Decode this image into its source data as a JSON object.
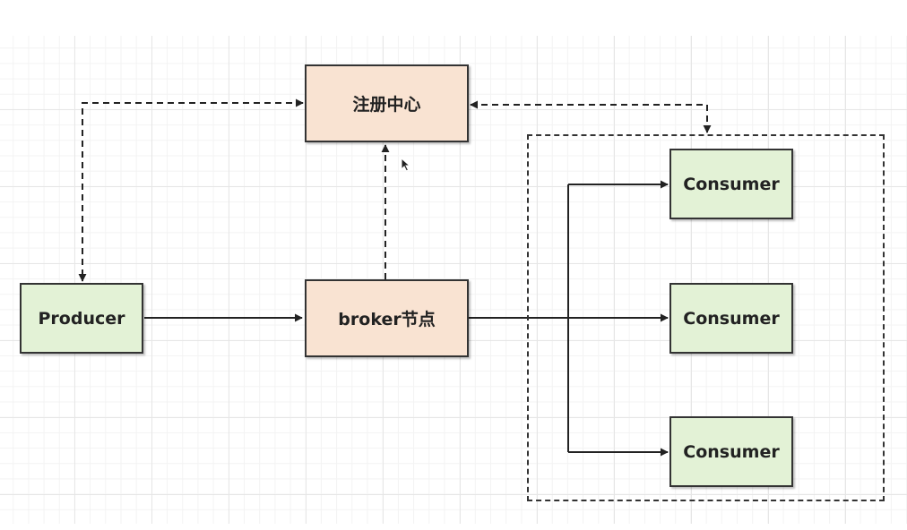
{
  "diagram": {
    "nodes": {
      "registry": {
        "label": "注册中心"
      },
      "producer": {
        "label": "Producer"
      },
      "broker": {
        "label": "broker节点"
      },
      "consumer_1": {
        "label": "Consumer"
      },
      "consumer_2": {
        "label": "Consumer"
      },
      "consumer_3": {
        "label": "Consumer"
      }
    },
    "edges": [
      {
        "from": "registry",
        "to": "producer",
        "style": "dashed",
        "arrows": "both"
      },
      {
        "from": "broker",
        "to": "registry",
        "style": "dashed",
        "arrows": "end"
      },
      {
        "from": "registry",
        "to": "consumer-group",
        "style": "dashed",
        "arrows": "both"
      },
      {
        "from": "producer",
        "to": "broker",
        "style": "solid",
        "arrows": "end"
      },
      {
        "from": "broker",
        "to": "consumer_1",
        "style": "solid",
        "arrows": "end"
      },
      {
        "from": "broker",
        "to": "consumer_2",
        "style": "solid",
        "arrows": "end"
      },
      {
        "from": "broker",
        "to": "consumer_3",
        "style": "solid",
        "arrows": "end"
      }
    ],
    "colors": {
      "server_fill": "#f9e3d2",
      "client_fill": "#e3f2d6",
      "stroke": "#333333"
    }
  }
}
